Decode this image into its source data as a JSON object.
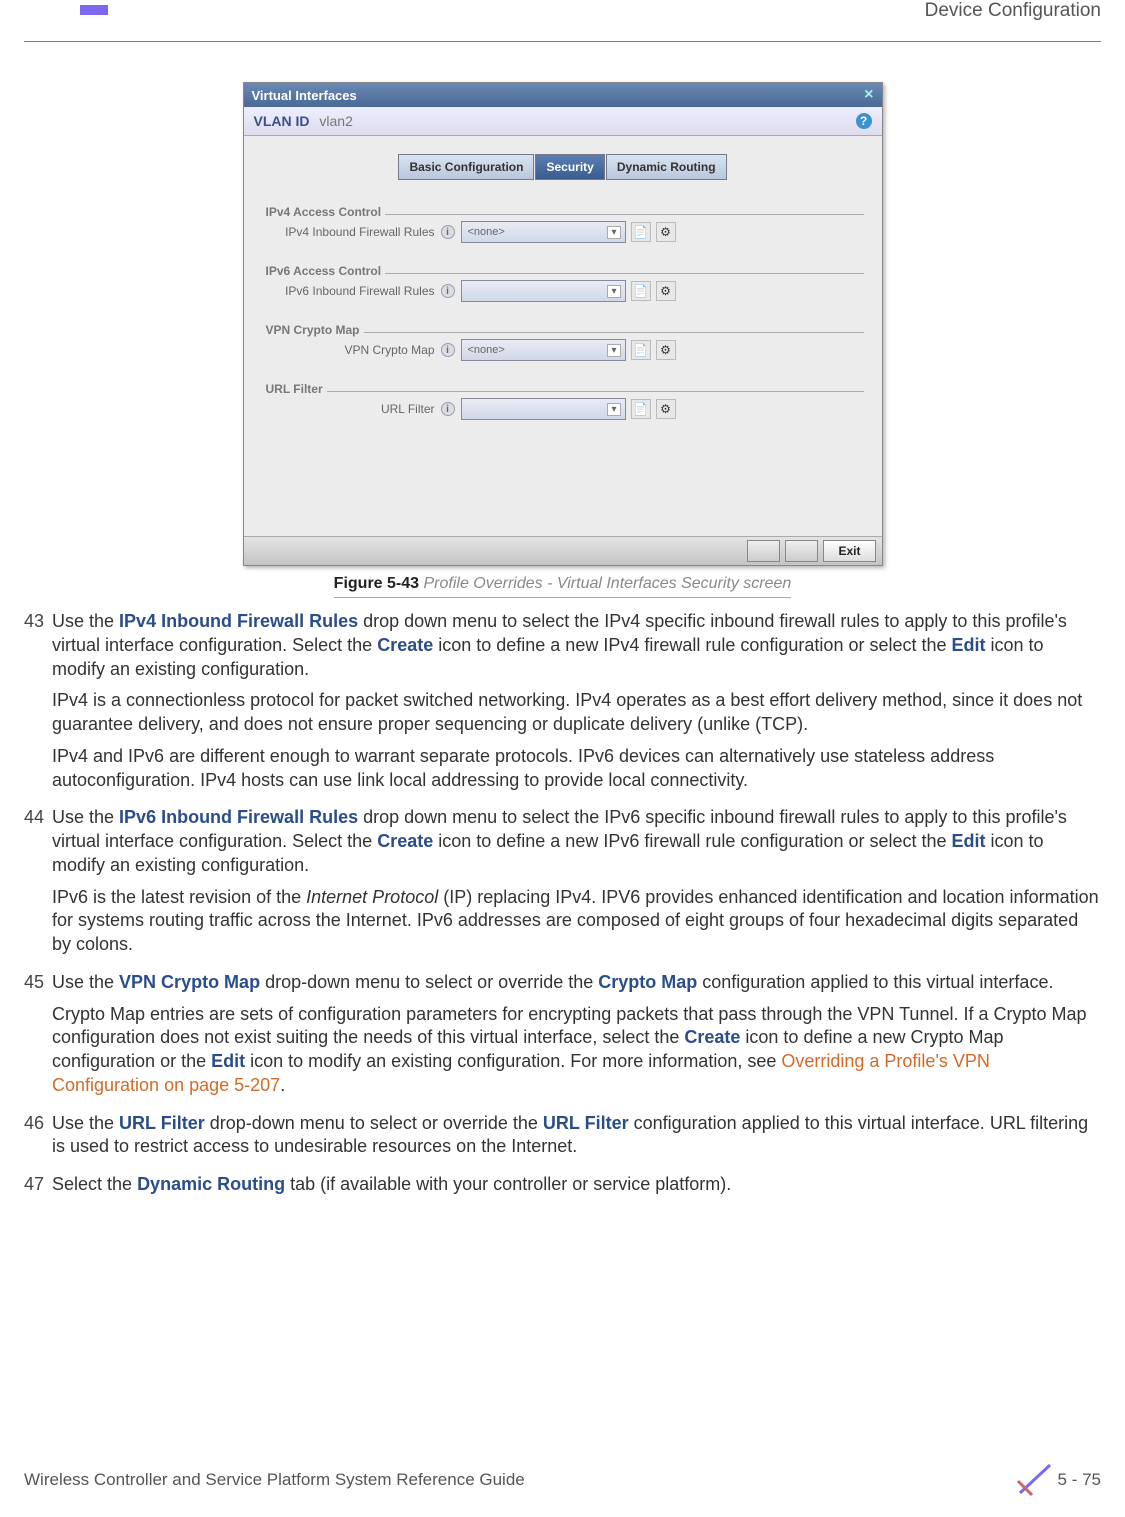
{
  "header": {
    "section": "Device Configuration"
  },
  "screenshot": {
    "title": "Virtual Interfaces",
    "vlan_label": "VLAN ID",
    "vlan_value": "vlan2",
    "tabs": {
      "basic": "Basic Configuration",
      "security": "Security",
      "dynamic": "Dynamic Routing"
    },
    "groups": {
      "ipv4_ac": "IPv4 Access Control",
      "ipv4_rules": "IPv4 Inbound Firewall Rules",
      "ipv6_ac": "IPv6 Access Control",
      "ipv6_rules": "IPv6 Inbound Firewall Rules",
      "vpn_grp": "VPN Crypto Map",
      "vpn_label": "VPN Crypto Map",
      "url_grp": "URL Filter",
      "url_label": "URL Filter"
    },
    "dd_none": "<none>",
    "dd_empty": "",
    "buttons": {
      "exit": "Exit"
    }
  },
  "caption": {
    "prefix": "Figure 5-43",
    "text": "Profile Overrides - Virtual Interfaces Security screen"
  },
  "items": [
    {
      "num": "43",
      "paras": [
        {
          "segs": [
            {
              "t": "Use the "
            },
            {
              "t": "IPv4 Inbound Firewall Rules",
              "cls": "bb"
            },
            {
              "t": " drop down menu to select the IPv4 specific inbound firewall rules to apply to this profile's virtual interface configuration. Select the "
            },
            {
              "t": "Create",
              "cls": "bb"
            },
            {
              "t": " icon to define a new IPv4 firewall rule configuration or select the "
            },
            {
              "t": "Edit",
              "cls": "bb"
            },
            {
              "t": " icon to modify an existing configuration."
            }
          ]
        },
        {
          "segs": [
            {
              "t": "IPv4 is a connectionless protocol for packet switched networking. IPv4 operates as a best effort delivery method, since it does not guarantee delivery, and does not ensure proper sequencing or duplicate delivery (unlike (TCP)."
            }
          ]
        },
        {
          "segs": [
            {
              "t": "IPv4 and IPv6 are different enough to warrant separate protocols. IPv6 devices can alternatively use stateless address autoconfiguration. IPv4 hosts can use link local addressing to provide local connectivity."
            }
          ]
        }
      ]
    },
    {
      "num": "44",
      "paras": [
        {
          "segs": [
            {
              "t": "Use the "
            },
            {
              "t": "IPv6 Inbound Firewall Rules",
              "cls": "bb"
            },
            {
              "t": " drop down menu to select the IPv6 specific inbound firewall rules to apply to this profile's virtual interface configuration. Select the "
            },
            {
              "t": "Create",
              "cls": "bb"
            },
            {
              "t": " icon to define a new IPv6 firewall rule configuration or select the "
            },
            {
              "t": "Edit",
              "cls": "bb"
            },
            {
              "t": " icon to modify an existing configuration."
            }
          ]
        },
        {
          "segs": [
            {
              "t": "IPv6 is the latest revision of the "
            },
            {
              "t": "Internet Protocol",
              "cls": "ital"
            },
            {
              "t": " (IP) replacing IPv4. IPV6 provides enhanced identification and location information for systems routing traffic across the Internet. IPv6 addresses are composed of eight groups of four hexadecimal digits separated by colons."
            }
          ]
        }
      ]
    },
    {
      "num": "45",
      "paras": [
        {
          "segs": [
            {
              "t": "Use the "
            },
            {
              "t": "VPN Crypto Map",
              "cls": "bb"
            },
            {
              "t": " drop-down menu to select or override the "
            },
            {
              "t": "Crypto Map",
              "cls": "bb"
            },
            {
              "t": " configuration applied to this virtual interface."
            }
          ]
        },
        {
          "segs": [
            {
              "t": "Crypto Map entries are sets of configuration parameters for encrypting packets that pass through the VPN Tunnel. If a Crypto Map configuration does not exist suiting the needs of this virtual interface, select the "
            },
            {
              "t": "Create",
              "cls": "bb"
            },
            {
              "t": " icon to define a new Crypto Map configuration or the "
            },
            {
              "t": "Edit",
              "cls": "bb"
            },
            {
              "t": " icon to modify an existing configuration. For more information, see "
            },
            {
              "t": "Overriding a Profile's VPN Configuration on page 5-207",
              "cls": "olink"
            },
            {
              "t": "."
            }
          ]
        }
      ]
    },
    {
      "num": "46",
      "paras": [
        {
          "segs": [
            {
              "t": "Use the "
            },
            {
              "t": "URL Filter",
              "cls": "bb"
            },
            {
              "t": " drop-down menu to select or override the "
            },
            {
              "t": "URL Filter",
              "cls": "bb"
            },
            {
              "t": " configuration applied to this virtual interface. URL filtering is used to restrict access to undesirable resources on the Internet."
            }
          ]
        }
      ]
    },
    {
      "num": "47",
      "paras": [
        {
          "segs": [
            {
              "t": "Select the "
            },
            {
              "t": "Dynamic Routing",
              "cls": "bb"
            },
            {
              "t": " tab (if available with your controller or service platform)."
            }
          ]
        }
      ]
    }
  ],
  "footer": {
    "guide": "Wireless Controller and Service Platform System Reference Guide",
    "page": "5 - 75"
  }
}
